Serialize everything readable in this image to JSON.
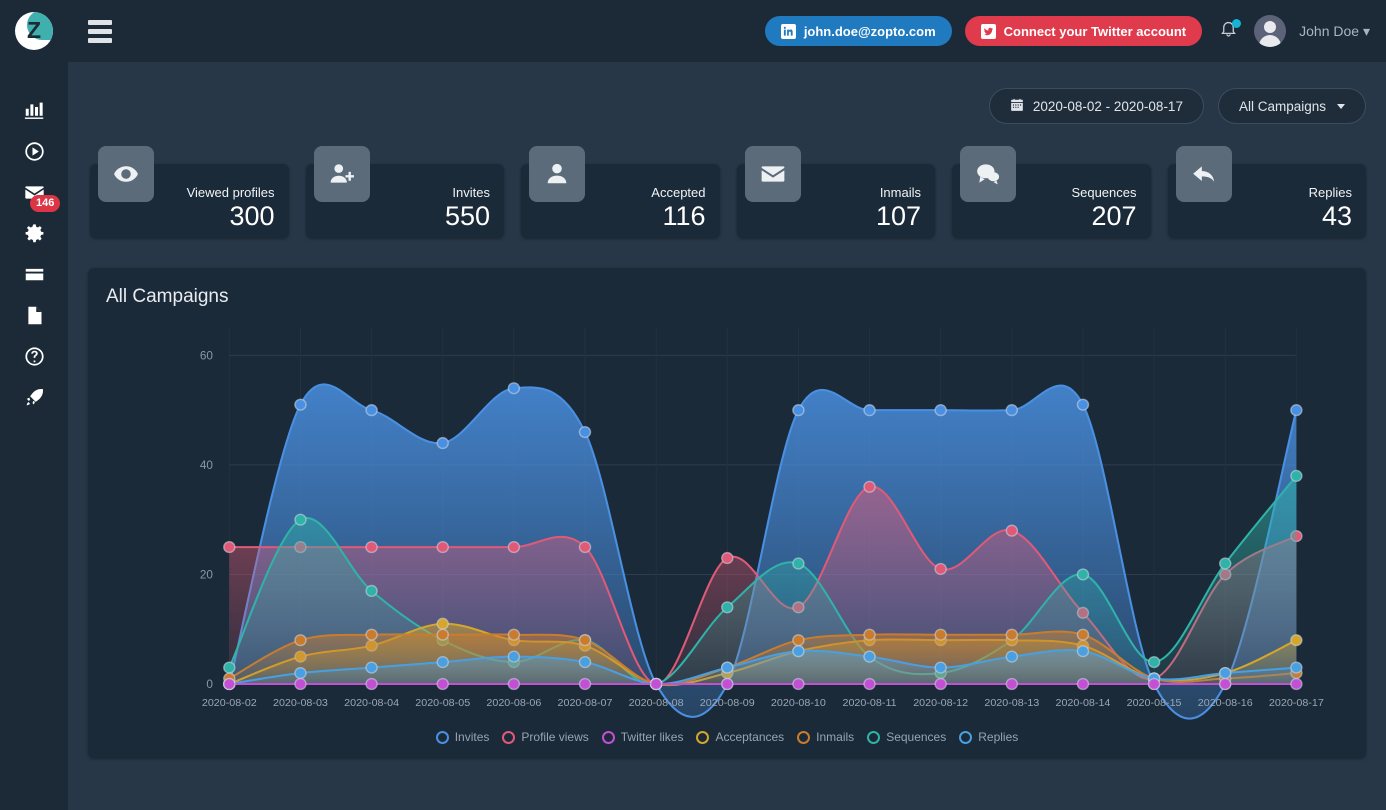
{
  "brand": {
    "logo_letter": "Z",
    "accent": "#3fb0ad"
  },
  "sidebar": {
    "items": [
      {
        "name": "analytics",
        "icon": "bar-chart-icon",
        "badge": null
      },
      {
        "name": "campaigns",
        "icon": "play-circle-icon",
        "badge": null
      },
      {
        "name": "inbox",
        "icon": "envelope-icon",
        "badge": "146"
      },
      {
        "name": "settings",
        "icon": "gear-icon",
        "badge": null
      },
      {
        "name": "billing",
        "icon": "credit-card-icon",
        "badge": null
      },
      {
        "name": "documents",
        "icon": "document-icon",
        "badge": null
      },
      {
        "name": "help",
        "icon": "question-circle-icon",
        "badge": null
      },
      {
        "name": "upgrade",
        "icon": "rocket-icon",
        "badge": null
      }
    ]
  },
  "topbar": {
    "menu_icon": "hamburger-icon",
    "linkedin_account": "john.doe@zopto.com",
    "twitter_connect": "Connect your Twitter account",
    "notifications_icon": "bell-icon",
    "has_notification": true,
    "username": "John Doe"
  },
  "controls": {
    "date_range": "2020-08-02 - 2020-08-17",
    "calendar_icon": "calendar-icon",
    "campaign_filter": "All Campaigns"
  },
  "stats": [
    {
      "label": "Viewed profiles",
      "value": "300",
      "icon": "eye-icon"
    },
    {
      "label": "Invites",
      "value": "550",
      "icon": "user-plus-icon"
    },
    {
      "label": "Accepted",
      "value": "116",
      "icon": "user-icon"
    },
    {
      "label": "Inmails",
      "value": "107",
      "icon": "envelope-icon"
    },
    {
      "label": "Sequences",
      "value": "207",
      "icon": "chat-icon"
    },
    {
      "label": "Replies",
      "value": "43",
      "icon": "reply-icon"
    }
  ],
  "panel": {
    "title": "All Campaigns"
  },
  "chart_data": {
    "type": "area",
    "title": "All Campaigns",
    "xlabel": "",
    "ylabel": "",
    "ylim": [
      0,
      65
    ],
    "yticks": [
      0,
      20,
      40,
      60
    ],
    "grid": true,
    "legend_position": "bottom",
    "smoothing": "spline",
    "categories": [
      "2020-08-02",
      "2020-08-03",
      "2020-08-04",
      "2020-08-05",
      "2020-08-06",
      "2020-08-07",
      "2020-08-08",
      "2020-08-09",
      "2020-08-10",
      "2020-08-11",
      "2020-08-12",
      "2020-08-13",
      "2020-08-14",
      "2020-08-15",
      "2020-08-16",
      "2020-08-17"
    ],
    "series": [
      {
        "name": "Invites",
        "color": "#4a90e2",
        "values": [
          0,
          51,
          50,
          44,
          54,
          46,
          0,
          0,
          50,
          50,
          50,
          50,
          51,
          0,
          0,
          50
        ]
      },
      {
        "name": "Profile views",
        "color": "#e05a78",
        "values": [
          25,
          25,
          25,
          25,
          25,
          25,
          0,
          23,
          14,
          36,
          21,
          28,
          13,
          1,
          20,
          27
        ]
      },
      {
        "name": "Twitter likes",
        "color": "#c34fd4",
        "values": [
          0,
          0,
          0,
          0,
          0,
          0,
          0,
          0,
          0,
          0,
          0,
          0,
          0,
          0,
          0,
          0
        ]
      },
      {
        "name": "Acceptances",
        "color": "#d4a72c",
        "values": [
          0,
          5,
          7,
          11,
          8,
          7,
          0,
          2,
          6,
          8,
          8,
          8,
          7,
          1,
          2,
          8
        ]
      },
      {
        "name": "Inmails",
        "color": "#c97c2e",
        "values": [
          1,
          8,
          9,
          9,
          9,
          8,
          0,
          3,
          8,
          9,
          9,
          9,
          9,
          1,
          1,
          2
        ]
      },
      {
        "name": "Sequences",
        "color": "#2fb3a8",
        "values": [
          3,
          30,
          17,
          8,
          4,
          8,
          0,
          14,
          22,
          5,
          2,
          8,
          20,
          4,
          22,
          38
        ]
      },
      {
        "name": "Replies",
        "color": "#4a9fe0",
        "values": [
          0,
          2,
          3,
          4,
          5,
          4,
          0,
          3,
          6,
          5,
          3,
          5,
          6,
          1,
          2,
          3
        ]
      }
    ]
  }
}
